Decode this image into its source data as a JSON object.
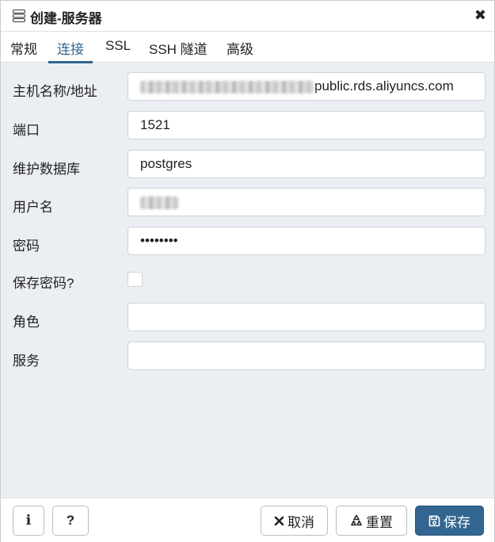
{
  "dialog": {
    "title": "创建-服务器",
    "close_label": "✖"
  },
  "tabs": [
    {
      "label": "常规"
    },
    {
      "label": "连接"
    },
    {
      "label": "SSL"
    },
    {
      "label": "SSH 隧道"
    },
    {
      "label": "高级"
    }
  ],
  "active_tab": "连接",
  "fields": {
    "host": {
      "label": "主机名称/地址",
      "value_visible": "public.rds.aliyuncs.com"
    },
    "port": {
      "label": "端口",
      "value": "1521"
    },
    "maintenance_db": {
      "label": "维护数据库",
      "value": "postgres"
    },
    "username": {
      "label": "用户名"
    },
    "password": {
      "label": "密码",
      "value": "••••••••"
    },
    "save_password": {
      "label": "保存密码?",
      "checked": false
    },
    "role": {
      "label": "角色",
      "value": ""
    },
    "service": {
      "label": "服务",
      "value": ""
    }
  },
  "footer": {
    "info_label": "i",
    "help_label": "?",
    "cancel_label": "取消",
    "reset_label": "重置",
    "save_label": "保存"
  },
  "colors": {
    "accent": "#326690",
    "background": "#ebeef2",
    "border": "#ced4da"
  },
  "icons": {
    "title": "server-icon",
    "close": "close-icon",
    "cancel": "close-icon",
    "reset": "recycle-icon",
    "save": "floppy-disk-icon"
  }
}
